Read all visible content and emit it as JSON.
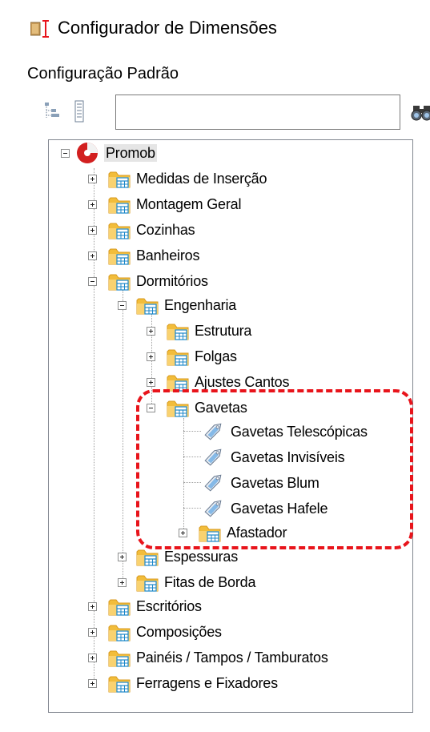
{
  "window": {
    "title": "Configurador de Dimensões",
    "icon": "dimension-ruler-icon"
  },
  "panel": {
    "label": "Configuração Padrão"
  },
  "toolbar": {
    "search": {
      "value": "",
      "placeholder": ""
    },
    "buttons": [
      "expand-tree-icon",
      "collapse-tree-icon",
      "binoculars-icon"
    ]
  },
  "tree": {
    "root": "Promob",
    "medidas": "Medidas de Inserção",
    "montagem": "Montagem Geral",
    "cozinhas": "Cozinhas",
    "banheiros": "Banheiros",
    "dormitorios": "Dormitórios",
    "engenharia": "Engenharia",
    "estrutura": "Estrutura",
    "folgas": "Folgas",
    "ajustes": "Ajustes Cantos",
    "gavetas": "Gavetas",
    "gav_telescopicas": "Gavetas Telescópicas",
    "gav_invisiveis": "Gavetas Invisíveis",
    "gav_blum": "Gavetas Blum",
    "gav_hafele": "Gavetas Hafele",
    "afastador": "Afastador",
    "espessuras": "Espessuras",
    "fitas": "Fitas de Borda",
    "escritorios": "Escritórios",
    "composicoes": "Composições",
    "paineis": "Painéis / Tampos / Tamburatos",
    "ferragens": "Ferragens e Fixadores"
  },
  "colors": {
    "highlight": "#e8141b",
    "folder": "#f6c54a",
    "folder_tab": "#e8a923",
    "table_icon": "#1c87c9",
    "promob_logo": "#d21f1f"
  }
}
